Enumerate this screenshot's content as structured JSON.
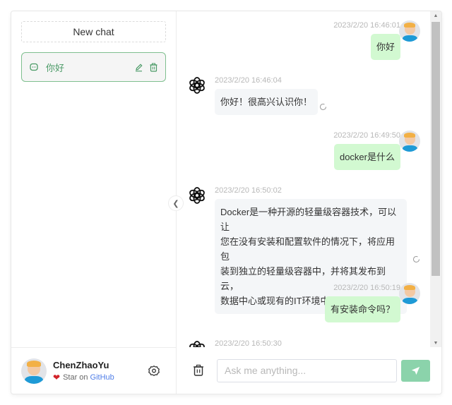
{
  "sidebar": {
    "new_chat_label": "New chat",
    "history": [
      {
        "label": "你好",
        "icon": "chat-bubble-icon",
        "active": true
      }
    ],
    "footer": {
      "user_name": "ChenZhaoYu",
      "star_prefix": "Star on",
      "github_label": "GitHub"
    }
  },
  "messages": [
    {
      "role": "user",
      "time": "2023/2/20 16:46:01",
      "text": "你好"
    },
    {
      "role": "assistant",
      "time": "2023/2/20 16:46:04",
      "text": "你好！很高兴认识你！"
    },
    {
      "role": "user",
      "time": "2023/2/20 16:49:50",
      "text": "docker是什么"
    },
    {
      "role": "assistant",
      "time": "2023/2/20 16:50:02",
      "lines": [
        "Docker是一种开源的轻量级容器技术，可以让",
        "您在没有安装和配置软件的情况下，将应用包",
        "装到独立的轻量级容器中，并将其发布到云，",
        "数据中心或现有的IT环境中。"
      ]
    },
    {
      "role": "user",
      "time": "2023/2/20 16:50:19",
      "text": "有安装命令吗？"
    },
    {
      "role": "assistant",
      "time": "2023/2/20 16:50:30",
      "text": ""
    }
  ],
  "input": {
    "placeholder": "Ask me anything...",
    "value": ""
  },
  "colors": {
    "accent": "#4a9a66",
    "user_bubble": "#d2f9d1",
    "bot_bubble": "#f4f6f8",
    "send_button": "#8bd3ab",
    "github_link": "#4f7ee8"
  }
}
